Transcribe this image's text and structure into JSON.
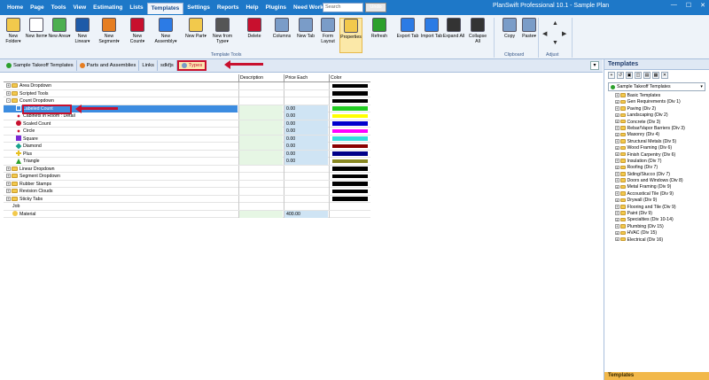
{
  "menu": {
    "items": [
      "Home",
      "Page",
      "Tools",
      "View",
      "Estimating",
      "Lists",
      "Templates",
      "Settings",
      "Reports",
      "Help",
      "Plugins",
      "Need Work?"
    ],
    "active": "Templates",
    "search_placeholder": "Search",
    "undo_label": "Undo",
    "app_title": "PlanSwift Professional 10.1 - Sample Plan"
  },
  "ribbon": {
    "buttons": [
      {
        "label": "New Folder",
        "dd": "▾",
        "icon": "new-folder-icon",
        "color": "#f2c94c"
      },
      {
        "label": "New Item",
        "dd": "▾",
        "icon": "new-item-icon",
        "color": "#ffffff"
      },
      {
        "label": "New Area",
        "dd": "▾",
        "icon": "new-area-icon",
        "color": "#4caf50"
      },
      {
        "label": "New Linear",
        "dd": "▾",
        "icon": "new-linear-icon",
        "color": "#1e5aa8"
      },
      {
        "label": "New Segment",
        "dd": "▾",
        "icon": "new-segment-icon",
        "color": "#e67e22"
      },
      {
        "label": "New Count",
        "dd": "▾",
        "icon": "new-count-icon",
        "color": "#c8102e"
      },
      {
        "label": "New Assembly",
        "dd": "▾",
        "icon": "new-assembly-icon",
        "color": "#2c7be5"
      },
      {
        "label": "New Part",
        "dd": "▾",
        "icon": "new-part-icon",
        "color": "#f2c94c"
      },
      {
        "label": "New from Type",
        "dd": "▾",
        "icon": "new-from-type-icon",
        "color": "#555555"
      },
      {
        "label": "Delete",
        "dd": "",
        "icon": "delete-icon",
        "color": "#c8102e"
      },
      {
        "label": "Columns",
        "dd": "",
        "icon": "columns-icon",
        "color": "#7a9cc8"
      },
      {
        "label": "New Tab",
        "dd": "",
        "icon": "new-tab-icon",
        "color": "#7a9cc8"
      },
      {
        "label": "Form Layout",
        "dd": "",
        "icon": "form-layout-icon",
        "color": "#7a9cc8"
      },
      {
        "label": "Properties",
        "dd": "",
        "icon": "properties-icon",
        "color": "#f2c94c"
      },
      {
        "label": "Refresh",
        "dd": "",
        "icon": "refresh-icon",
        "color": "#2ca02c"
      },
      {
        "label": "Export Tab",
        "dd": "",
        "icon": "export-tab-icon",
        "color": "#2c7be5"
      },
      {
        "label": "Import Tab",
        "dd": "",
        "icon": "import-tab-icon",
        "color": "#2c7be5"
      },
      {
        "label": "Expand All",
        "dd": "",
        "icon": "expand-all-icon",
        "color": "#333333"
      },
      {
        "label": "Collapse All",
        "dd": "",
        "icon": "collapse-all-icon",
        "color": "#333333"
      },
      {
        "label": "Copy",
        "dd": "",
        "icon": "copy-icon",
        "color": "#7a9cc8"
      },
      {
        "label": "Paste",
        "dd": "▾",
        "icon": "paste-icon",
        "color": "#7a9cc8"
      }
    ],
    "groups": [
      "Template Tools",
      "Clipboard",
      "Adjust"
    ]
  },
  "tabs": [
    {
      "label": "Sample Takeoff Templates",
      "icon": "globe-icon"
    },
    {
      "label": "Parts and Assemblies",
      "icon": "parts-icon"
    },
    {
      "label": "Links",
      "icon": ""
    },
    {
      "label": "sdkfjs",
      "icon": ""
    },
    {
      "label": "Types",
      "icon": "types-icon"
    }
  ],
  "grid": {
    "headers": {
      "name": "",
      "description": "Description",
      "price": "Price Each",
      "color": "Color"
    },
    "rows": [
      {
        "name": "Area Dropdown",
        "kind": "folder",
        "exp": "+",
        "indent": 0,
        "price": "",
        "color": "#000000"
      },
      {
        "name": "Scripted Tools",
        "kind": "folder",
        "exp": "+",
        "indent": 0,
        "price": "",
        "color": "#000000"
      },
      {
        "name": "Count Dropdown",
        "kind": "folder",
        "exp": "-",
        "indent": 0,
        "price": "",
        "color": "#000000"
      },
      {
        "name": "Labeled Count",
        "kind": "labeled",
        "exp": "",
        "indent": 1,
        "price": "0.00",
        "color": "#22cc22",
        "selected": true
      },
      {
        "name": "Cabinets in Room : Detail",
        "kind": "dots",
        "exp": "",
        "indent": 1,
        "price": "0.00",
        "color": "#ffff00"
      },
      {
        "name": "Scaled Count",
        "kind": "red-circle",
        "exp": "",
        "indent": 1,
        "price": "0.00",
        "color": "#0000cc"
      },
      {
        "name": "Circle",
        "kind": "dots",
        "exp": "",
        "indent": 1,
        "price": "0.00",
        "color": "#ff00ff"
      },
      {
        "name": "Square",
        "kind": "square",
        "exp": "",
        "indent": 1,
        "price": "0.00",
        "color": "#33dddd"
      },
      {
        "name": "Diamond",
        "kind": "diamond",
        "exp": "",
        "indent": 1,
        "price": "0.00",
        "color": "#8b0000"
      },
      {
        "name": "Plus",
        "kind": "plus",
        "exp": "",
        "indent": 1,
        "price": "0.00",
        "color": "#000088"
      },
      {
        "name": "Triangle",
        "kind": "triangle",
        "exp": "",
        "indent": 1,
        "price": "0.00",
        "color": "#888822"
      },
      {
        "name": "Linear Dropdown",
        "kind": "folder",
        "exp": "+",
        "indent": 0,
        "price": "",
        "color": "#000000"
      },
      {
        "name": "Segment Dropdown",
        "kind": "folder",
        "exp": "+",
        "indent": 0,
        "price": "",
        "color": "#000000"
      },
      {
        "name": "Rubber Stamps",
        "kind": "folder",
        "exp": "+",
        "indent": 0,
        "price": "",
        "color": "#000000"
      },
      {
        "name": "Revision Clouds",
        "kind": "folder",
        "exp": "+",
        "indent": 0,
        "price": "",
        "color": "#000000"
      },
      {
        "name": "Sticky Tabs",
        "kind": "folder",
        "exp": "+",
        "indent": 0,
        "price": "",
        "color": "#000000"
      },
      {
        "name": "Job",
        "kind": "none",
        "exp": "",
        "indent": 0,
        "price": "",
        "color": ""
      },
      {
        "name": "Material",
        "kind": "material",
        "exp": "",
        "indent": 0,
        "price": "400.00",
        "color": ""
      }
    ]
  },
  "right_panel": {
    "title": "Templates",
    "toolbar": [
      "+",
      "↺",
      "▣",
      "◫",
      "▤",
      "▦",
      "✕"
    ],
    "selected_template": "Sample Takeoff Templates",
    "items": [
      "Basic Templates",
      "Gen Requirements (Div 1)",
      "Paving (Div 2)",
      "Landscaping (Div 2)",
      "Concrete (Div 3)",
      "Rebar/Vapor Barriers (Div 3)",
      "Masonry (Div 4)",
      "Structural Metals (Div 5)",
      "Wood Framing (Div 6)",
      "Finish Carpentry (Div 6)",
      "Insulation (Div 7)",
      "Roofing (Div 7)",
      "Siding/Stucco (Div 7)",
      "Doors and Windows (Div 8)",
      "Metal Framing (Div 9)",
      "Accoustical Tile (Div 9)",
      "Drywall (Div 9)",
      "Flooring and Tile (Div 9)",
      "Paint (Div 9)",
      "Specialties (Div 10-14)",
      "Plumbing (Div 15)",
      "HVAC (Div 15)",
      "Electrical (Div 16)"
    ],
    "footer": "Templates"
  }
}
